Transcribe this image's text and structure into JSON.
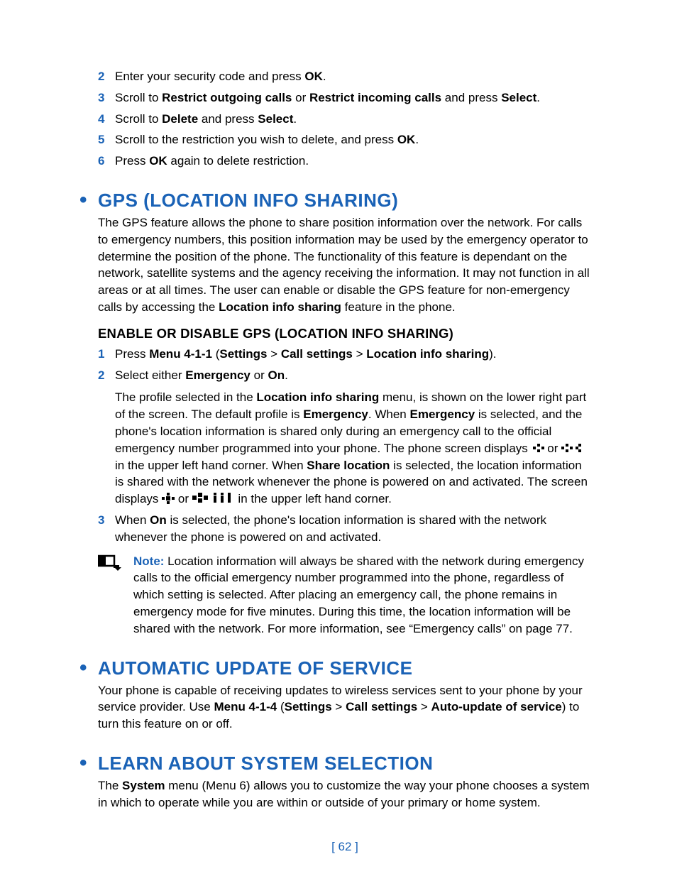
{
  "steps_top": [
    {
      "num": "2",
      "parts": [
        {
          "t": "Enter your security code and press "
        },
        {
          "t": "OK",
          "b": true
        },
        {
          "t": "."
        }
      ]
    },
    {
      "num": "3",
      "parts": [
        {
          "t": "Scroll to "
        },
        {
          "t": "Restrict outgoing calls",
          "b": true
        },
        {
          "t": " or "
        },
        {
          "t": "Restrict incoming calls",
          "b": true
        },
        {
          "t": " and press "
        },
        {
          "t": "Select",
          "b": true
        },
        {
          "t": "."
        }
      ]
    },
    {
      "num": "4",
      "parts": [
        {
          "t": "Scroll to "
        },
        {
          "t": "Delete",
          "b": true
        },
        {
          "t": " and press "
        },
        {
          "t": "Select",
          "b": true
        },
        {
          "t": "."
        }
      ]
    },
    {
      "num": "5",
      "parts": [
        {
          "t": "Scroll to the restriction you wish to delete, and press "
        },
        {
          "t": "OK",
          "b": true
        },
        {
          "t": "."
        }
      ]
    },
    {
      "num": "6",
      "parts": [
        {
          "t": "Press "
        },
        {
          "t": "OK",
          "b": true
        },
        {
          "t": " again to delete restriction."
        }
      ]
    }
  ],
  "gps": {
    "heading": "GPS (LOCATION INFO SHARING)",
    "intro_parts": [
      {
        "t": "The GPS feature allows the phone to share position information over the network. For calls to emergency numbers, this position information may be used by the emergency operator to determine the position of the phone. The functionality of this feature is dependant on the network, satellite systems and the agency receiving the information. It may not function in all areas or at all times. The user can enable or disable the GPS feature for non-emergency calls by accessing the "
      },
      {
        "t": "Location info sharing",
        "b": true
      },
      {
        "t": " feature in the phone."
      }
    ],
    "subheading": "ENABLE OR DISABLE GPS (LOCATION INFO SHARING)",
    "steps": [
      {
        "num": "1",
        "parts": [
          {
            "t": "Press "
          },
          {
            "t": "Menu 4-1-1",
            "b": true
          },
          {
            "t": " ("
          },
          {
            "t": "Settings",
            "b": true
          },
          {
            "t": " > "
          },
          {
            "t": "Call settings",
            "b": true
          },
          {
            "t": " > "
          },
          {
            "t": "Location info sharing",
            "b": true
          },
          {
            "t": ")."
          }
        ]
      },
      {
        "num": "2",
        "parts": [
          {
            "t": "Select either "
          },
          {
            "t": "Emergency",
            "b": true
          },
          {
            "t": " or "
          },
          {
            "t": "On",
            "b": true
          },
          {
            "t": "."
          }
        ],
        "followup_parts": [
          {
            "t": "The profile selected in the "
          },
          {
            "t": "Location info sharing",
            "b": true
          },
          {
            "t": " menu, is shown on the lower right part of the screen. The default profile is "
          },
          {
            "t": "Emergency",
            "b": true
          },
          {
            "t": ". When "
          },
          {
            "t": "Emergency",
            "b": true
          },
          {
            "t": " is selected, and the phone's location information is shared only during an emergency call to the official emergency number programmed into your phone. The phone screen displays "
          },
          {
            "icon": "gps-small-icon"
          },
          {
            "t": " or "
          },
          {
            "icon": "gps-wide-icon"
          },
          {
            "t": " in the upper left hand corner. When "
          },
          {
            "t": "Share location",
            "b": true
          },
          {
            "t": " is selected, the location information is shared with the network whenever the phone is powered on and activated. The screen displays "
          },
          {
            "icon": "gps-dot-icon"
          },
          {
            "t": " or "
          },
          {
            "icon": "gps-bars-icon"
          },
          {
            "t": " in the upper left hand corner."
          }
        ]
      },
      {
        "num": "3",
        "parts": [
          {
            "t": "When "
          },
          {
            "t": "On",
            "b": true
          },
          {
            "t": " is selected, the phone's location information is shared with the network whenever the phone is powered on and activated."
          }
        ]
      }
    ],
    "note_label": "Note:",
    "note_text": " Location information will always be shared with the network during emergency calls to the official emergency number programmed into the phone, regardless of which setting is selected. After placing an emergency call, the phone remains in emergency mode for five minutes. During this time, the location information will be shared with the network. For more information, see “Emergency calls” on page 77."
  },
  "auto": {
    "heading": "AUTOMATIC UPDATE OF SERVICE",
    "parts": [
      {
        "t": "Your phone is capable of receiving updates to wireless services sent to your phone by your service provider. Use "
      },
      {
        "t": "Menu 4-1-4",
        "b": true
      },
      {
        "t": " ("
      },
      {
        "t": "Settings",
        "b": true
      },
      {
        "t": " > "
      },
      {
        "t": "Call settings",
        "b": true
      },
      {
        "t": " > "
      },
      {
        "t": "Auto-update of service",
        "b": true
      },
      {
        "t": ") to turn this feature on or off."
      }
    ]
  },
  "learn": {
    "heading": "LEARN ABOUT SYSTEM SELECTION",
    "parts": [
      {
        "t": "The "
      },
      {
        "t": "System",
        "b": true
      },
      {
        "t": " menu (Menu 6) allows you to customize the way your phone chooses a system in which to operate while you are within or outside of your primary or home system."
      }
    ]
  },
  "page_number": "[ 62 ]"
}
